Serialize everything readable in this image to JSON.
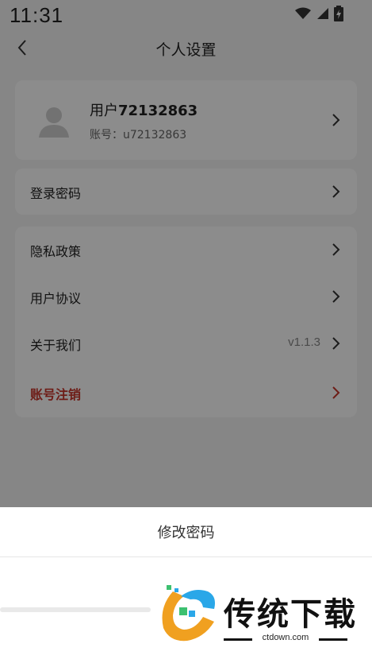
{
  "status": {
    "time": "11:31"
  },
  "nav": {
    "title": "个人设置"
  },
  "profile": {
    "name_prefix": "用户",
    "name_number": "72132863",
    "account_text": "账号：u72132863"
  },
  "security": {
    "login_password": "登录密码"
  },
  "settings": {
    "items": [
      {
        "label": "隐私政策"
      },
      {
        "label": "用户协议"
      },
      {
        "label": "关于我们",
        "value": "v1.1.3"
      },
      {
        "label": "账号注销"
      }
    ]
  },
  "sheet": {
    "title": "修改密码"
  },
  "watermark": {
    "text": "传统下载",
    "url": "ctdown.com"
  },
  "colors": {
    "danger": "#c8352b",
    "overlay": "#000000",
    "accent": "#2aa7e8"
  }
}
